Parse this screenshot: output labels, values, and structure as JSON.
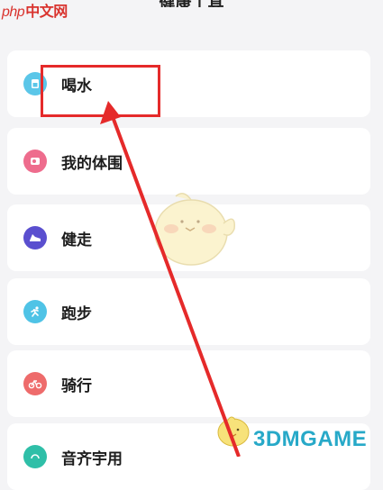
{
  "header": {
    "title": "健康工具"
  },
  "watermarks": {
    "php_prefix": "php",
    "php_site": "中文网",
    "game_site": "3DMGAME"
  },
  "tools": [
    {
      "label": "喝水",
      "icon": "water-cup-icon",
      "color": "#5bc6e8"
    },
    {
      "label": "我的体围",
      "icon": "tape-measure-icon",
      "color": "#ee6c8d"
    },
    {
      "label": "健走",
      "icon": "shoe-icon",
      "color": "#5a4fcf"
    },
    {
      "label": "跑步",
      "icon": "running-icon",
      "color": "#4fc3e6"
    },
    {
      "label": "骑行",
      "icon": "bicycle-icon",
      "color": "#ee6b6b"
    },
    {
      "label": "音齐宇用",
      "icon": "headphone-icon",
      "color": "#2fbfa8"
    }
  ],
  "annotation": {
    "highlight_color": "#e52a2a"
  }
}
